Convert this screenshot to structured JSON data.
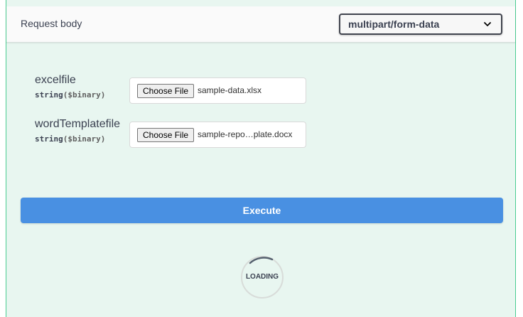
{
  "request_body": {
    "title": "Request body",
    "content_type": "multipart/form-data"
  },
  "params": [
    {
      "name": "excelfile",
      "type": "string",
      "format": "($binary)",
      "button_label": "Choose File",
      "file_name": "sample-data.xlsx"
    },
    {
      "name": "wordTemplatefile",
      "type": "string",
      "format": "($binary)",
      "button_label": "Choose File",
      "file_name": "sample-repo…plate.docx"
    }
  ],
  "execute": {
    "label": "Execute",
    "color": "#4990e2"
  },
  "loading": {
    "text": "LOADING"
  },
  "colors": {
    "panel_background": "#e8f6f0",
    "panel_border": "#49cc90"
  }
}
